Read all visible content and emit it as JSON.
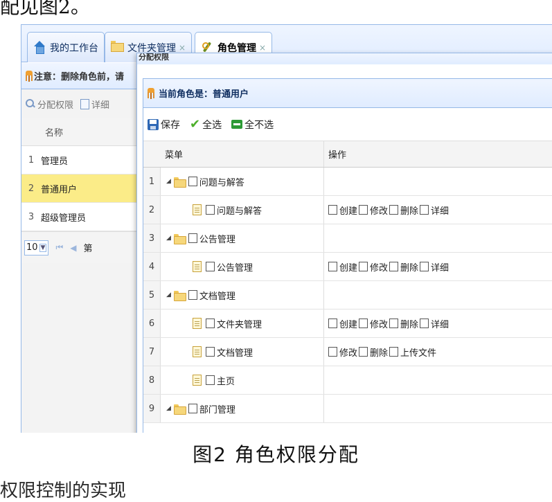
{
  "top_text": "配见图2。",
  "tabs": [
    {
      "label": "我的工作台",
      "icon": "home-icon",
      "closable": false
    },
    {
      "label": "文件夹管理",
      "icon": "folder-icon",
      "closable": true
    },
    {
      "label": "角色管理",
      "icon": "wrench-icon",
      "closable": true,
      "active": true
    }
  ],
  "close_glyph": "×",
  "left_panel": {
    "notice": "注意：删除角色前，请",
    "toolbar": {
      "assign_label": "分配权限",
      "detail_label": "详细"
    },
    "column_header": "名称",
    "rows": [
      {
        "num": "1",
        "name": "管理员"
      },
      {
        "num": "2",
        "name": "普通用户",
        "selected": true
      },
      {
        "num": "3",
        "name": "超级管理员"
      }
    ],
    "pager": {
      "page_size": "10",
      "first": "⏮",
      "prev": "◀",
      "page_label": "第"
    }
  },
  "dialog": {
    "title": "分配权限",
    "role_label": "当前角色是：普通用户",
    "toolbar": {
      "save": "保存",
      "select_all": "全选",
      "select_none": "全不选"
    },
    "columns": {
      "menu": "菜单",
      "ops": "操作"
    },
    "rows": [
      {
        "num": "1",
        "type": "folder",
        "label": "问题与解答",
        "ops": []
      },
      {
        "num": "2",
        "type": "file",
        "label": "问题与解答",
        "ops": [
          "创建",
          "修改",
          "删除",
          "详细"
        ]
      },
      {
        "num": "3",
        "type": "folder",
        "label": "公告管理",
        "ops": []
      },
      {
        "num": "4",
        "type": "file",
        "label": "公告管理",
        "ops": [
          "创建",
          "修改",
          "删除",
          "详细"
        ]
      },
      {
        "num": "5",
        "type": "folder",
        "label": "文档管理",
        "ops": []
      },
      {
        "num": "6",
        "type": "file",
        "label": "文件夹管理",
        "ops": [
          "创建",
          "修改",
          "删除",
          "详细"
        ]
      },
      {
        "num": "7",
        "type": "file",
        "label": "文档管理",
        "ops": [
          "修改",
          "删除",
          "上传文件"
        ]
      },
      {
        "num": "8",
        "type": "file",
        "label": "主页",
        "ops": []
      },
      {
        "num": "9",
        "type": "folder",
        "label": "部门管理",
        "ops": []
      }
    ]
  },
  "caption": "图2  角色权限分配",
  "bottom_text": "权限控制的实现"
}
